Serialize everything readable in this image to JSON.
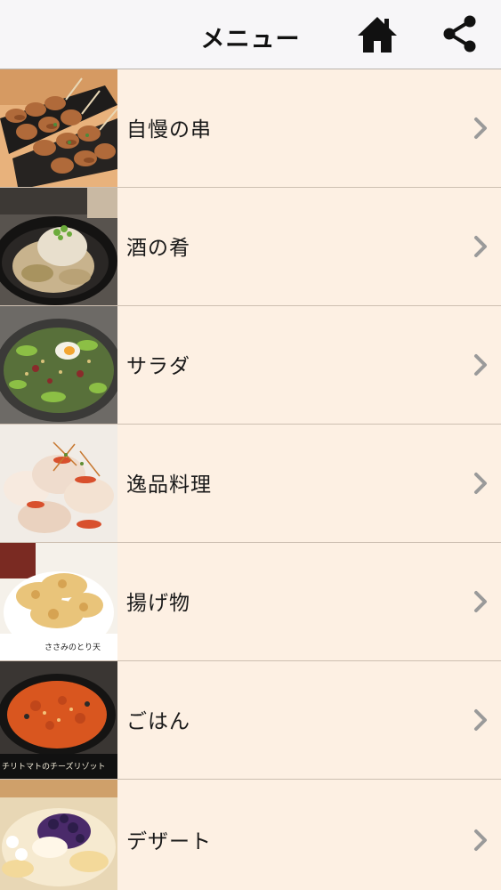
{
  "header": {
    "title": "メニュー",
    "home_icon": "home-icon",
    "share_icon": "share-icon"
  },
  "menu": {
    "items": [
      {
        "label": "自慢の串",
        "image": "yakitori-skewers"
      },
      {
        "label": "酒の肴",
        "image": "snack-dish-bowl"
      },
      {
        "label": "サラダ",
        "image": "salad"
      },
      {
        "label": "逸品料理",
        "image": "special-dish"
      },
      {
        "label": "揚げ物",
        "image": "fried-food",
        "image_caption": "ささみのとり天"
      },
      {
        "label": "ごはん",
        "image": "risotto",
        "image_caption": "チリトマトのチーズリゾット"
      },
      {
        "label": "デザート",
        "image": "dessert"
      }
    ]
  },
  "colors": {
    "header_bg": "#f7f6f8",
    "row_bg": "#fdf0e3",
    "divider": "#cdbfb1",
    "chevron": "#9a9a9a"
  }
}
